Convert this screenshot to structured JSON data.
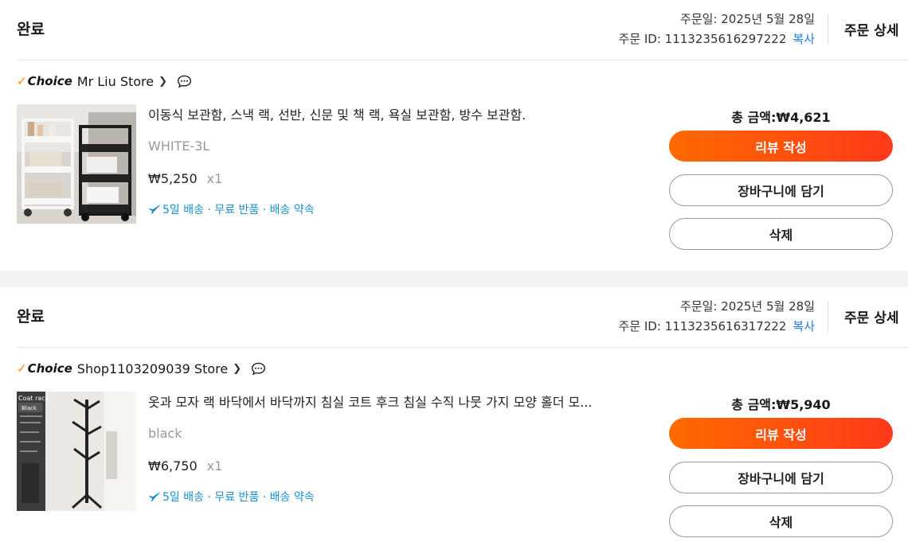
{
  "orders": [
    {
      "status": "완료",
      "order_date": "주문일: 2025년 5월 28일",
      "order_id": "주문 ID: 1113235616297222",
      "copy_label": "복사",
      "detail_label": "주문 상세",
      "choice_label": "Choice",
      "store_name": "Mr Liu Store",
      "product_title": "이동식 보관함, 스낵 랙, 선반, 신문 및 책 랙, 욕실 보관함, 방수 보관함.",
      "variant": "WHITE-3L",
      "price": "₩5,250",
      "qty": "x1",
      "shipping": "5일 배송 · 무료 반품 · 배송 약속",
      "total": "총 금액:₩4,621",
      "review_label": "리뷰 작성",
      "cart_label": "장바구니에 담기",
      "delete_label": "삭제"
    },
    {
      "status": "완료",
      "order_date": "주문일: 2025년 5월 28일",
      "order_id": "주문 ID: 1113235616317222",
      "copy_label": "복사",
      "detail_label": "주문 상세",
      "choice_label": "Choice",
      "store_name": "Shop1103209039 Store",
      "product_title": "옷과 모자 랙 바닥에서 바닥까지 침실 코트 후크 침실 수직 나뭇 가지 모양 홀더 모...",
      "variant": "black",
      "price": "₩6,750",
      "qty": "x1",
      "shipping": "5일 배송 · 무료 반품 · 배송 약속",
      "total": "총 금액:₩5,940",
      "review_label": "리뷰 작성",
      "cart_label": "장바구니에 담기",
      "delete_label": "삭제",
      "thumb_text": {
        "title": "Coat rack",
        "color": "Black"
      }
    }
  ],
  "colors": {
    "accent": "#ff5a12",
    "link": "#1f7ee6",
    "shipping": "#1a8fc9",
    "choice_check": "#ff8a00"
  }
}
